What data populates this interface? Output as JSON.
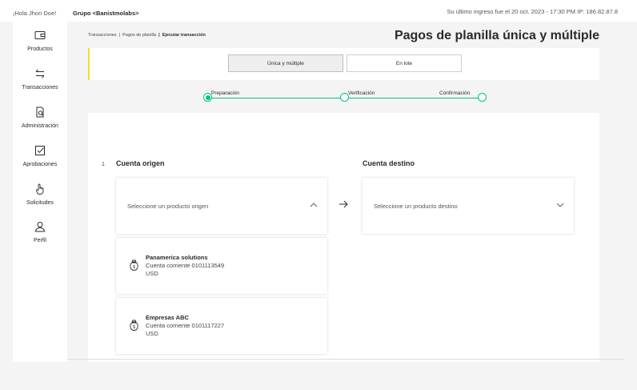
{
  "header": {
    "greeting": "¡Hola Jhon Doe!",
    "group": "Grupo <Banistmolabs>",
    "last_login": "Su último ingreso fue el 20 oct. 2023 - 17:30 PM IP: 186.82.87.8"
  },
  "sidebar": {
    "items": [
      {
        "label": "Productos",
        "icon": "wallet-icon"
      },
      {
        "label": "Transacciones",
        "icon": "transfer-arrows-icon"
      },
      {
        "label": "Administración",
        "icon": "document-search-icon"
      },
      {
        "label": "Aprobaciones",
        "icon": "checkbox-icon"
      },
      {
        "label": "Solicitudes",
        "icon": "hand-pointer-icon"
      },
      {
        "label": "Perfil",
        "icon": "user-icon"
      }
    ]
  },
  "breadcrumb": {
    "items": [
      "Transacciones",
      "Pagos de planilla"
    ],
    "separator": "|",
    "current": "Ejecutar transacción"
  },
  "page_title": "Pagos de planilla única y múltiple",
  "tabs": [
    {
      "label": "Única y múltiple",
      "active": true
    },
    {
      "label": "En lote",
      "active": false
    }
  ],
  "steps": [
    {
      "label": "Preparación",
      "status": "current"
    },
    {
      "label": "Verificación",
      "status": "pending"
    },
    {
      "label": "Confirmación",
      "status": "pending"
    }
  ],
  "form": {
    "step_number": "1",
    "origin": {
      "title": "Cuenta origen",
      "placeholder": "Seleccione un producto origen",
      "expanded": true
    },
    "destination": {
      "title": "Cuenta destino",
      "placeholder": "Seleccione un producto destino",
      "expanded": false
    },
    "origin_options": [
      {
        "name": "Panamerica solutions",
        "account": "Cuenta corriente 0101113549",
        "currency": "USD",
        "icon": "money-bag-icon"
      },
      {
        "name": "Empresas ABC",
        "account": "Cuenta corriente 0101117227",
        "currency": "USD",
        "icon": "money-bag-icon"
      }
    ]
  },
  "colors": {
    "accent": "#00c389",
    "highlight": "#fdda24",
    "text": "#2c2a29"
  }
}
